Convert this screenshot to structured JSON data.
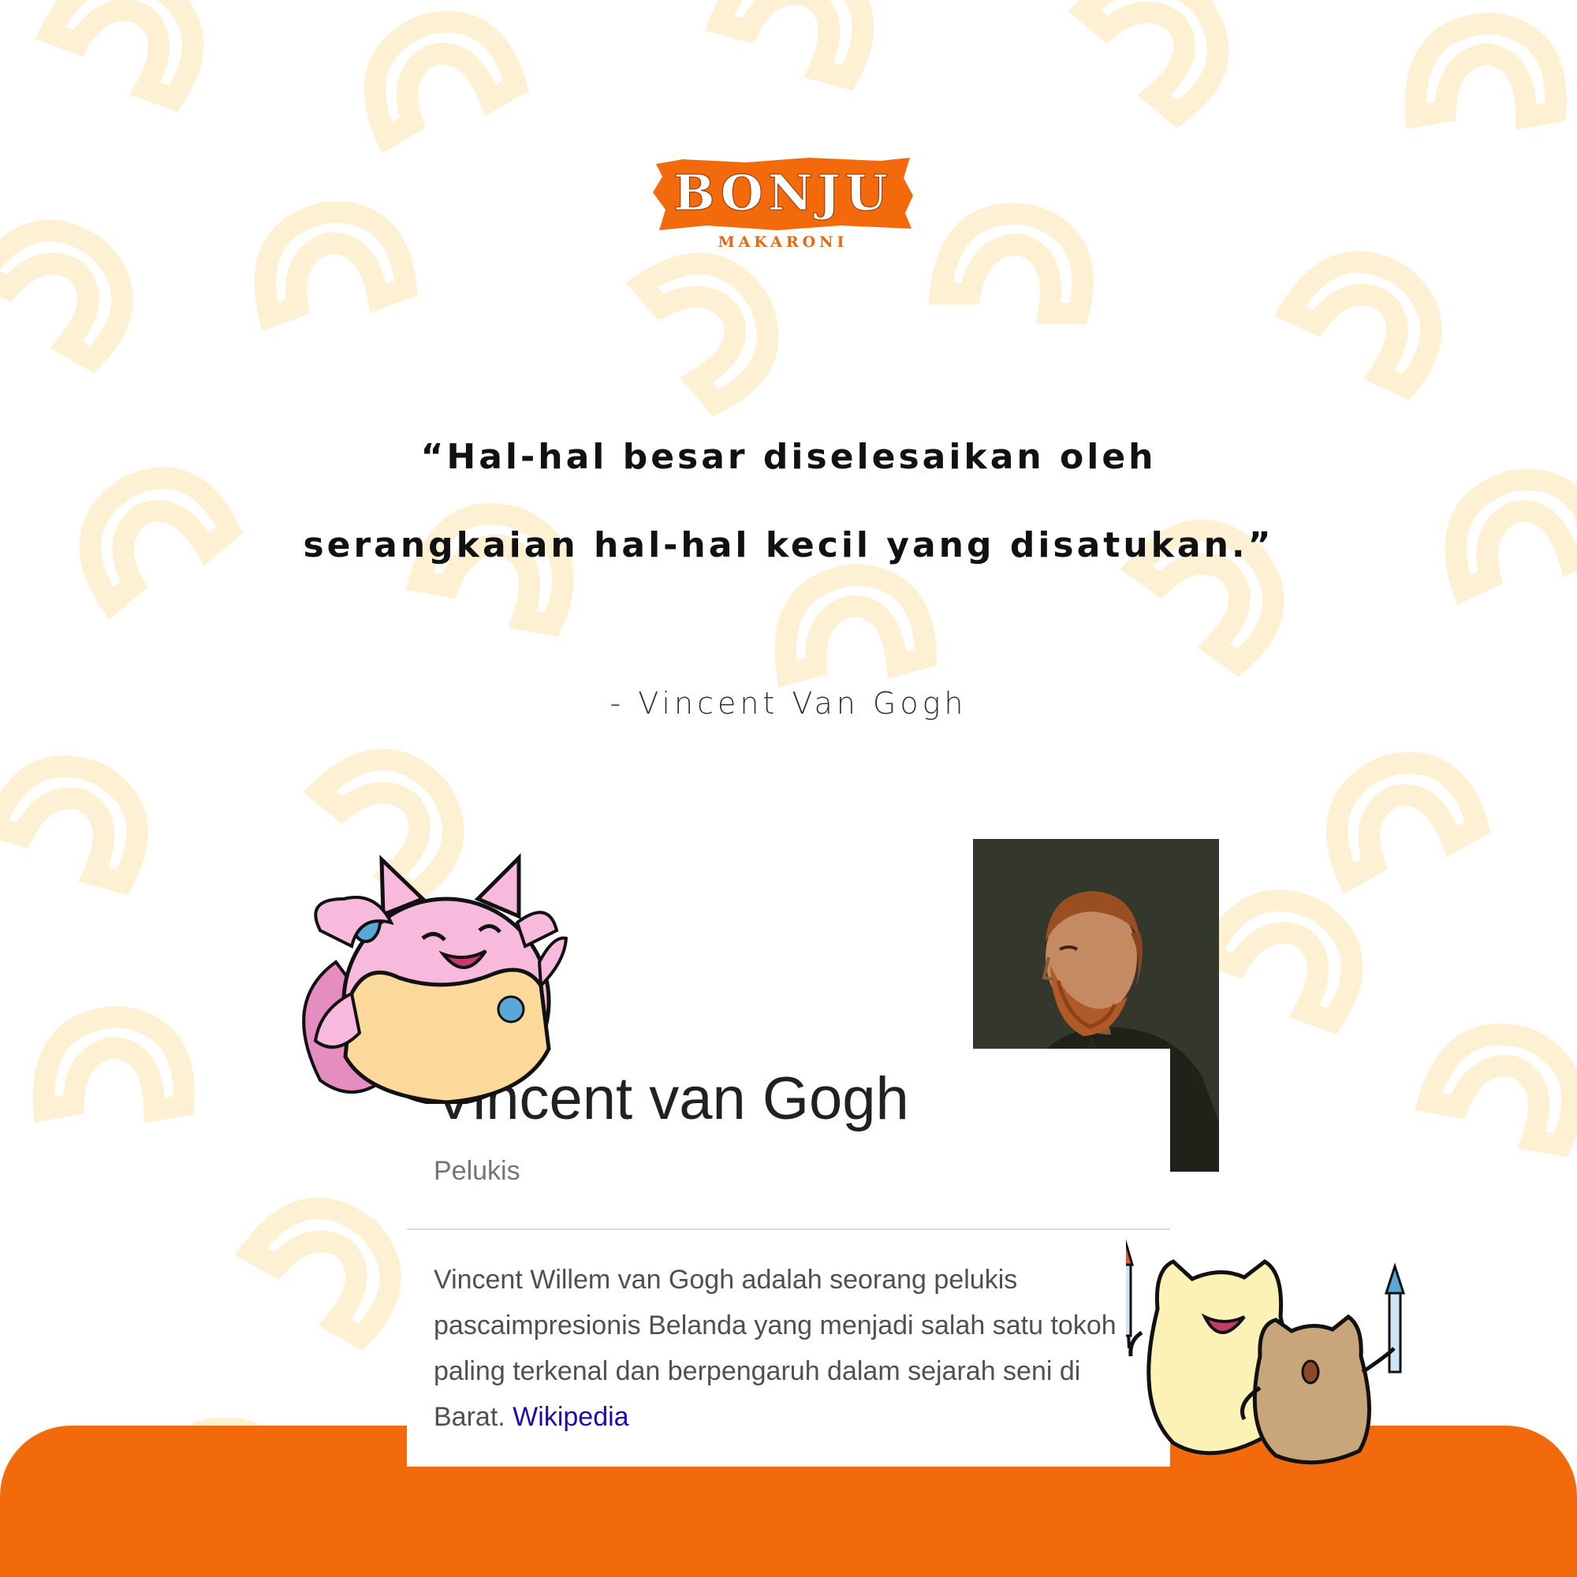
{
  "brand": {
    "name": "BONJU",
    "tagline": "MAKARONI",
    "accent_color": "#f26a0c",
    "pattern_color": "#fdf0d3"
  },
  "quote": {
    "line1": "“Hal-hal besar diselesaikan oleh",
    "line2": "serangkaian hal-hal kecil yang disatukan.”",
    "attribution": "-  Vincent Van Gogh"
  },
  "knowledge_card": {
    "title": "Vincent van Gogh",
    "subtitle": "Pelukis",
    "description": "Vincent Willem van Gogh adalah seorang pelukis pascaimpresionis Belanda yang menjadi salah satu tokoh paling terkenal dan berpengaruh dalam sejarah seni di Barat.",
    "source_link": "Wikipedia",
    "link_color": "#1a0dab"
  },
  "illustrations": {
    "portrait": "portrait-painting",
    "left_mascot": "pink-cat-mascot",
    "right_mascot": "cat-duo-with-fireworks"
  }
}
